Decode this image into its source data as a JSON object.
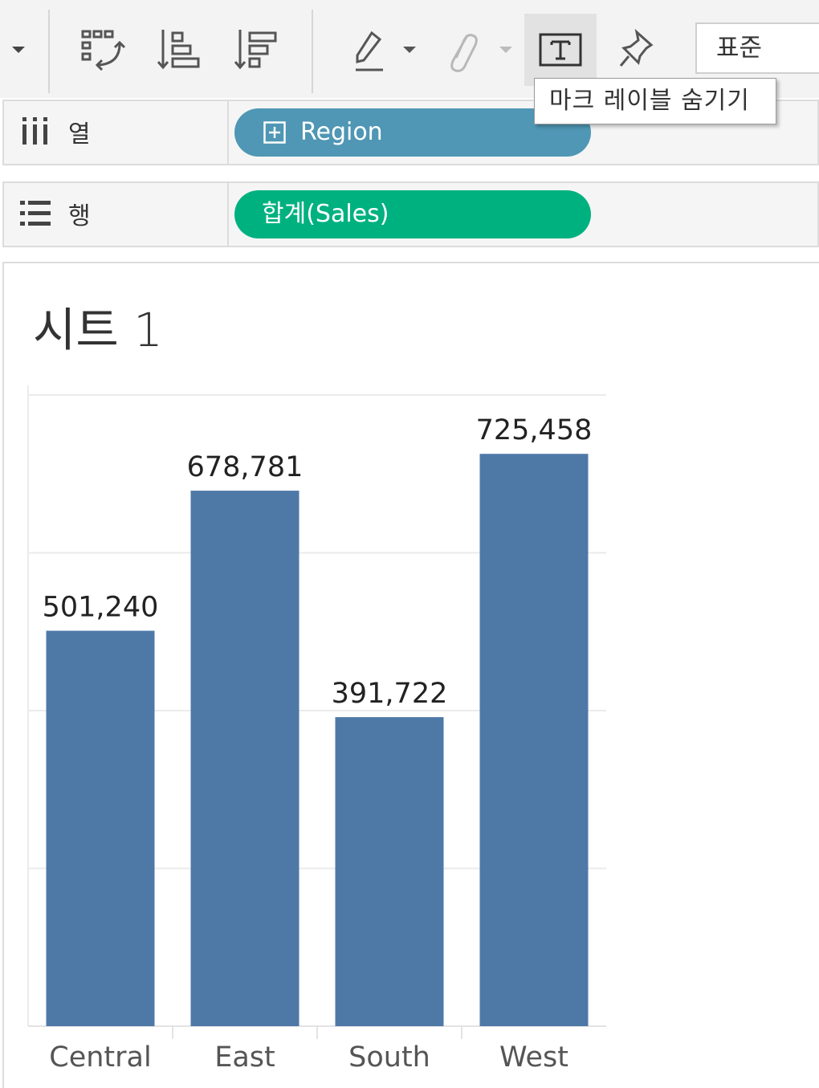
{
  "toolbar": {
    "icons": [
      "dropdown-arrow-icon",
      "swap-axes-icon",
      "sort-ascending-icon",
      "sort-descending-icon",
      "highlight-pen-icon",
      "paperclip-icon",
      "text-label-icon",
      "pin-icon"
    ],
    "fit_value": "표준",
    "tooltip": "마크 레이블 숨기기"
  },
  "shelves": {
    "columns": {
      "label": "열",
      "pill": "Region",
      "pill_color": "#4f97b4"
    },
    "rows": {
      "label": "행",
      "pill": "합계(Sales)",
      "pill_color": "#00b180"
    }
  },
  "sheet": {
    "title": "시트 1"
  },
  "chart_data": {
    "type": "bar",
    "categories": [
      "Central",
      "East",
      "South",
      "West"
    ],
    "values": [
      501240,
      678781,
      391722,
      725458
    ],
    "labels": [
      "501,240",
      "678,781",
      "391,722",
      "725,458"
    ],
    "bar_color": "#4e79a7",
    "ylim": [
      0,
      800000
    ],
    "grid": true
  }
}
